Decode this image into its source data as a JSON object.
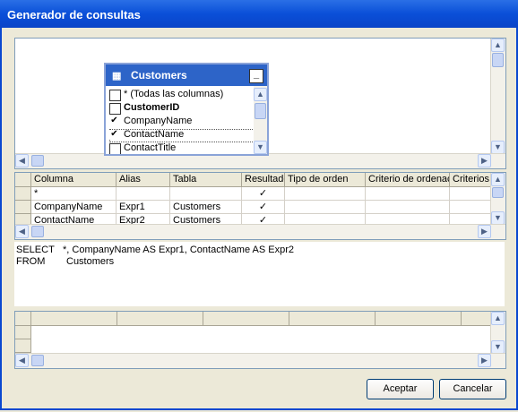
{
  "window": {
    "title": "Generador de consultas"
  },
  "diagram": {
    "table": {
      "name": "Customers",
      "minimize_label": "_",
      "columns": [
        {
          "label": "* (Todas las columnas)",
          "checked": false,
          "bold": false
        },
        {
          "label": "CustomerID",
          "checked": false,
          "bold": true
        },
        {
          "label": "CompanyName",
          "checked": true,
          "bold": false
        },
        {
          "label": "ContactName",
          "checked": true,
          "bold": false
        },
        {
          "label": "ContactTitle",
          "checked": false,
          "bold": false
        }
      ]
    }
  },
  "grid": {
    "headers": [
      "Columna",
      "Alias",
      "Tabla",
      "Resultado",
      "Tipo de orden",
      "Criterio de ordenación",
      "Criterios"
    ],
    "rows": [
      {
        "columna": "*",
        "alias": "",
        "tabla": "",
        "resultado": "✓"
      },
      {
        "columna": "CompanyName",
        "alias": "Expr1",
        "tabla": "Customers",
        "resultado": "✓"
      },
      {
        "columna": "ContactName",
        "alias": "Expr2",
        "tabla": "Customers",
        "resultado": "✓"
      }
    ]
  },
  "sql": {
    "select_keyword": "SELECT",
    "select_clause": "*, CompanyName AS Expr1, ContactName AS Expr2",
    "from_keyword": "FROM",
    "from_clause": "Customers"
  },
  "buttons": {
    "ok": "Aceptar",
    "cancel": "Cancelar"
  },
  "checkmark": "✔",
  "icons": {
    "table": "▦",
    "up": "▲",
    "down": "▼",
    "left": "◀",
    "right": "▶",
    "grip": "≡"
  }
}
